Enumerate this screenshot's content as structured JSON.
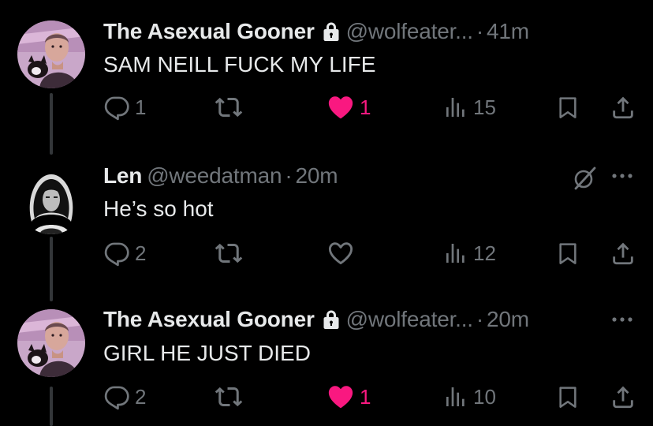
{
  "colors": {
    "background": "#000000",
    "text": "#e7e9ea",
    "muted": "#71767b",
    "like": "#f91880",
    "thread": "#333639"
  },
  "tweets": [
    {
      "name": "The Asexual Gooner",
      "locked": true,
      "handle": "@wolfeater...",
      "separator": "·",
      "time": "41m",
      "text": "SAM NEILL FUCK MY LIFE",
      "replies": "1",
      "reposts": "",
      "likes": "1",
      "liked": true,
      "views": "15",
      "icons": [
        "reply-icon",
        "repost-icon",
        "heart-icon",
        "views-icon",
        "bookmark-icon",
        "share-icon"
      ]
    },
    {
      "name": "Len",
      "locked": false,
      "handle": "@weedatman",
      "separator": "·",
      "time": "20m",
      "text": "He’s so hot",
      "replies": "2",
      "reposts": "",
      "likes": "",
      "liked": false,
      "views": "12",
      "icons": [
        "grok-icon",
        "more-icon",
        "reply-icon",
        "repost-icon",
        "heart-outline-icon",
        "views-icon",
        "bookmark-icon",
        "share-icon"
      ]
    },
    {
      "name": "The Asexual Gooner",
      "locked": true,
      "handle": "@wolfeater...",
      "separator": "·",
      "time": "20m",
      "text": "GIRL HE JUST DIED",
      "replies": "2",
      "reposts": "",
      "likes": "1",
      "liked": true,
      "views": "10",
      "icons": [
        "more-icon",
        "reply-icon",
        "repost-icon",
        "heart-icon",
        "views-icon",
        "bookmark-icon",
        "share-icon"
      ]
    }
  ]
}
